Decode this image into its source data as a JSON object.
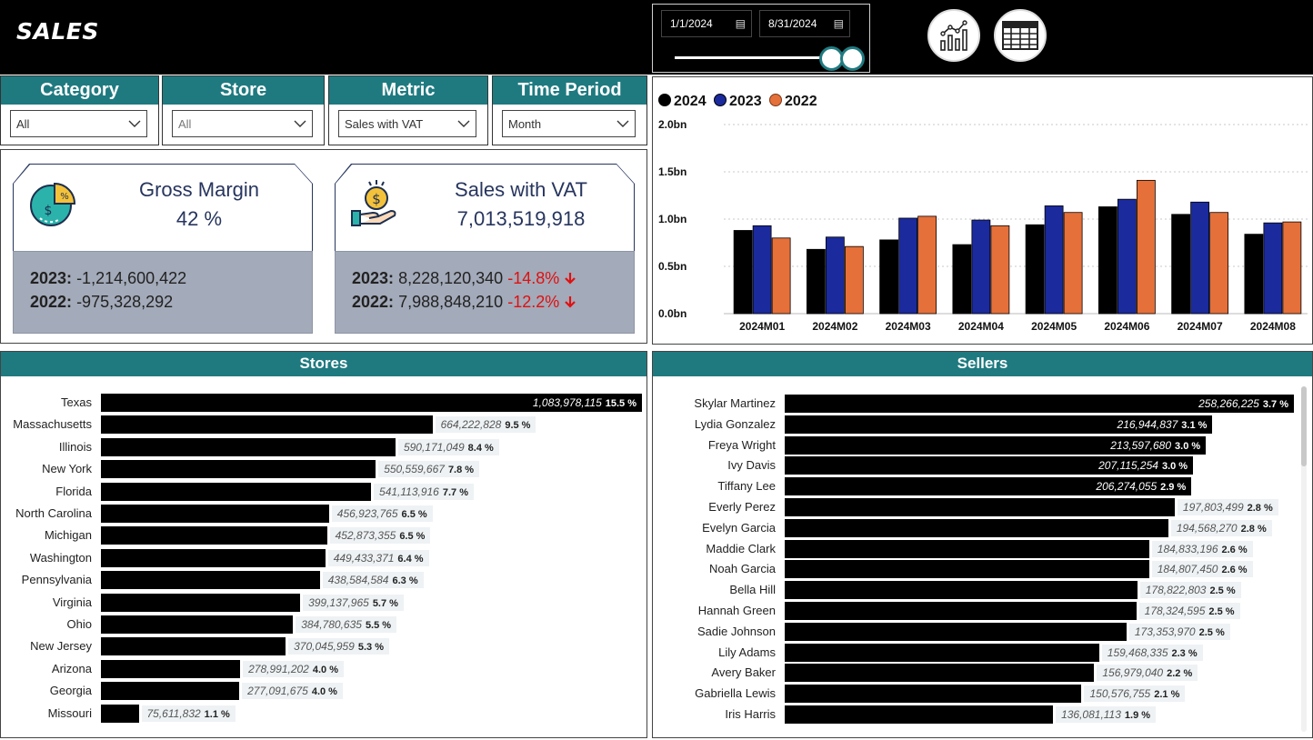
{
  "header": {
    "title": "SALES",
    "date_start": "1/1/2024",
    "date_end": "8/31/2024"
  },
  "filters": [
    {
      "label": "Category",
      "value": "All"
    },
    {
      "label": "Store",
      "value": "All"
    },
    {
      "label": "Metric",
      "value": "Sales with VAT"
    },
    {
      "label": "Time Period",
      "value": "Month"
    }
  ],
  "kpis": {
    "gross_margin": {
      "title": "Gross Margin",
      "value": "42 %",
      "line1_label": "2023:",
      "line1_value": "-1,214,600,422",
      "line2_label": "2022:",
      "line2_value": "-975,328,292"
    },
    "sales_vat": {
      "title": "Sales with VAT",
      "value": "7,013,519,918",
      "line1_label": "2023:",
      "line1_value": "8,228,120,340",
      "line1_change": "-14.8%",
      "line2_label": "2022:",
      "line2_value": "7,988,848,210",
      "line2_change": "-12.2%"
    }
  },
  "colors": {
    "accent": "#1f7a80",
    "y2024": "#000000",
    "y2023": "#1b2a9c",
    "y2022": "#e5703a",
    "negative": "#e01010",
    "kpi_footer": "#a3aab9",
    "kpi_text": "#27355e"
  },
  "chart_data": {
    "type": "bar",
    "categories": [
      "2024M01",
      "2024M02",
      "2024M03",
      "2024M04",
      "2024M05",
      "2024M06",
      "2024M07",
      "2024M08"
    ],
    "series": [
      {
        "name": "2024",
        "values": [
          0.88,
          0.68,
          0.78,
          0.73,
          0.94,
          1.13,
          1.05,
          0.84
        ]
      },
      {
        "name": "2023",
        "values": [
          0.93,
          0.81,
          1.01,
          0.99,
          1.14,
          1.21,
          1.18,
          0.96
        ]
      },
      {
        "name": "2022",
        "values": [
          0.8,
          0.71,
          1.03,
          0.93,
          1.07,
          1.41,
          1.07,
          0.97
        ]
      }
    ],
    "yticks": [
      "0.0bn",
      "0.5bn",
      "1.0bn",
      "1.5bn",
      "2.0bn"
    ],
    "ylim": [
      0,
      2.0
    ],
    "grid": true,
    "legend_position": "top-left"
  },
  "stores": {
    "title": "Stores",
    "rows": [
      {
        "name": "Texas",
        "value": 1083978115,
        "value_label": "1,083,978,115",
        "pct": "15.5 %"
      },
      {
        "name": "Massachusetts",
        "value": 664222828,
        "value_label": "664,222,828",
        "pct": "9.5 %"
      },
      {
        "name": "Illinois",
        "value": 590171049,
        "value_label": "590,171,049",
        "pct": "8.4 %"
      },
      {
        "name": "New York",
        "value": 550559667,
        "value_label": "550,559,667",
        "pct": "7.8 %"
      },
      {
        "name": "Florida",
        "value": 541113916,
        "value_label": "541,113,916",
        "pct": "7.7 %"
      },
      {
        "name": "North Carolina",
        "value": 456923765,
        "value_label": "456,923,765",
        "pct": "6.5 %"
      },
      {
        "name": "Michigan",
        "value": 452873355,
        "value_label": "452,873,355",
        "pct": "6.5 %"
      },
      {
        "name": "Washington",
        "value": 449433371,
        "value_label": "449,433,371",
        "pct": "6.4 %"
      },
      {
        "name": "Pennsylvania",
        "value": 438584584,
        "value_label": "438,584,584",
        "pct": "6.3 %"
      },
      {
        "name": "Virginia",
        "value": 399137965,
        "value_label": "399,137,965",
        "pct": "5.7 %"
      },
      {
        "name": "Ohio",
        "value": 384780635,
        "value_label": "384,780,635",
        "pct": "5.5 %"
      },
      {
        "name": "New Jersey",
        "value": 370045959,
        "value_label": "370,045,959",
        "pct": "5.3 %"
      },
      {
        "name": "Arizona",
        "value": 278991202,
        "value_label": "278,991,202",
        "pct": "4.0 %"
      },
      {
        "name": "Georgia",
        "value": 277091675,
        "value_label": "277,091,675",
        "pct": "4.0 %"
      },
      {
        "name": "Missouri",
        "value": 75611832,
        "value_label": "75,611,832",
        "pct": "1.1 %"
      }
    ]
  },
  "sellers": {
    "title": "Sellers",
    "rows": [
      {
        "name": "Skylar Martinez",
        "value": 258266225,
        "value_label": "258,266,225",
        "pct": "3.7 %"
      },
      {
        "name": "Lydia Gonzalez",
        "value": 216944837,
        "value_label": "216,944,837",
        "pct": "3.1 %"
      },
      {
        "name": "Freya Wright",
        "value": 213597680,
        "value_label": "213,597,680",
        "pct": "3.0 %"
      },
      {
        "name": "Ivy Davis",
        "value": 207115254,
        "value_label": "207,115,254",
        "pct": "3.0 %"
      },
      {
        "name": "Tiffany Lee",
        "value": 206274055,
        "value_label": "206,274,055",
        "pct": "2.9 %"
      },
      {
        "name": "Everly Perez",
        "value": 197803499,
        "value_label": "197,803,499",
        "pct": "2.8 %"
      },
      {
        "name": "Evelyn Garcia",
        "value": 194568270,
        "value_label": "194,568,270",
        "pct": "2.8 %"
      },
      {
        "name": "Maddie Clark",
        "value": 184833196,
        "value_label": "184,833,196",
        "pct": "2.6 %"
      },
      {
        "name": "Noah Garcia",
        "value": 184807450,
        "value_label": "184,807,450",
        "pct": "2.6 %"
      },
      {
        "name": "Bella Hill",
        "value": 178822803,
        "value_label": "178,822,803",
        "pct": "2.5 %"
      },
      {
        "name": "Hannah Green",
        "value": 178324595,
        "value_label": "178,324,595",
        "pct": "2.5 %"
      },
      {
        "name": "Sadie Johnson",
        "value": 173353970,
        "value_label": "173,353,970",
        "pct": "2.5 %"
      },
      {
        "name": "Lily Adams",
        "value": 159468335,
        "value_label": "159,468,335",
        "pct": "2.3 %"
      },
      {
        "name": "Avery Baker",
        "value": 156979040,
        "value_label": "156,979,040",
        "pct": "2.2 %"
      },
      {
        "name": "Gabriella Lewis",
        "value": 150576755,
        "value_label": "150,576,755",
        "pct": "2.1 %"
      },
      {
        "name": "Iris Harris",
        "value": 136081113,
        "value_label": "136,081,113",
        "pct": "1.9 %"
      }
    ]
  },
  "icons": {
    "chart_view": "line-bar-chart-icon",
    "table_view": "table-grid-icon",
    "gross_margin": "pie-percent-dollar-icon",
    "sales_vat": "hand-coin-icon",
    "negative_trend": "arrow-down-icon"
  }
}
